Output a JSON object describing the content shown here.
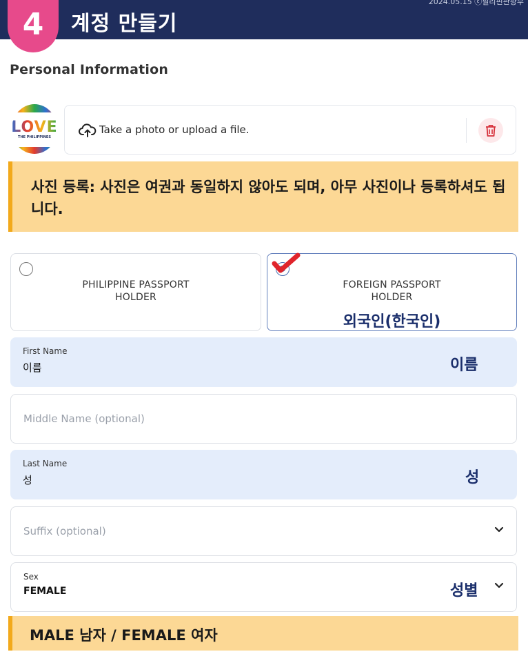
{
  "header": {
    "step_number": "4",
    "title": "계정 만들기",
    "date": "2024.05.15 ⓒ필리핀관광부"
  },
  "section_title": "Personal Information",
  "upload": {
    "logo_text": "LOVE",
    "logo_subtext": "THE PHILIPPINES",
    "label": "Take a photo or upload a file.",
    "upload_icon": "cloud-upload-icon",
    "delete_icon": "trash-icon"
  },
  "notice": {
    "text": "사진 등록: 사진은 여권과 동일하지 않아도 되며, 아무 사진이나 등록하셔도 됩니다."
  },
  "passport_options": [
    {
      "line1": "PHILIPPINE PASSPORT",
      "line2": "HOLDER",
      "selected": false
    },
    {
      "line1": "FOREIGN PASSPORT",
      "line2": "HOLDER",
      "selected": true,
      "annotation": "외국인(한국인)"
    }
  ],
  "fields": {
    "first_name": {
      "label": "First Name",
      "value": "이름",
      "annotation": "이름"
    },
    "middle_name": {
      "placeholder": "Middle Name (optional)"
    },
    "last_name": {
      "label": "Last Name",
      "value": "성",
      "annotation": "성"
    },
    "suffix": {
      "placeholder": "Suffix (optional)"
    },
    "sex": {
      "label": "Sex",
      "value": "FEMALE",
      "annotation": "성별"
    }
  },
  "bottom_notice": {
    "text": "MALE 남자 / FEMALE 여자"
  },
  "colors": {
    "header_bg": "#1f2d5c",
    "step_badge": "#e74a8b",
    "notice_bg": "#fcd895",
    "filled_field_bg": "#e4edfb",
    "annotation_text": "#1a2e6b",
    "check_mark": "#e0242b"
  }
}
